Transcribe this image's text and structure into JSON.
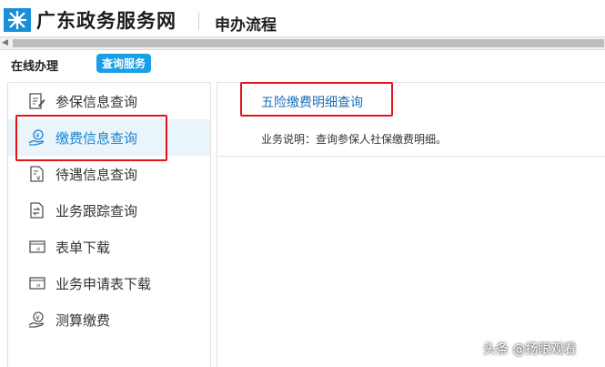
{
  "header": {
    "site_title": "广东政务服务网",
    "page_title": "申办流程"
  },
  "subnav": {
    "online_label": "在线办理",
    "query_label": "查询服务"
  },
  "sidebar": {
    "items": [
      {
        "label": "参保信息查询",
        "icon": "edit-document-icon",
        "active": false
      },
      {
        "label": "缴费信息查询",
        "icon": "hand-coin-icon",
        "active": true
      },
      {
        "label": "待遇信息查询",
        "icon": "money-document-icon",
        "active": false
      },
      {
        "label": "业务跟踪查询",
        "icon": "sync-document-icon",
        "active": false
      },
      {
        "label": "表单下载",
        "icon": "form-download-icon",
        "active": false
      },
      {
        "label": "业务申请表下载",
        "icon": "form-download-icon",
        "active": false
      },
      {
        "label": "测算缴费",
        "icon": "hand-coin-icon",
        "active": false
      }
    ]
  },
  "main": {
    "service_link": "五险缴费明细查询",
    "description": "业务说明：查询参保人社保缴费明细。"
  },
  "watermark": "头条 @扬眼观看",
  "colors": {
    "accent": "#1a9ee6",
    "highlight_box": "#e3151a",
    "active_bg": "#e9f4fb",
    "link": "#1a6fb8"
  }
}
